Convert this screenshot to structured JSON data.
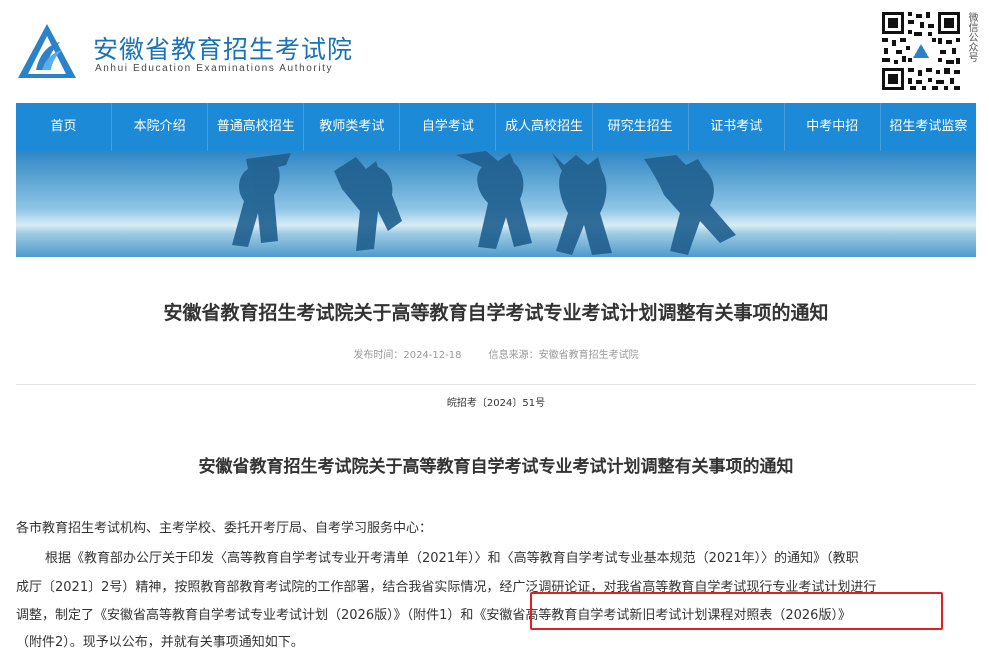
{
  "header": {
    "org_name_cn": "安徽省教育招生考试院",
    "org_name_en": "Anhui Education Examinations Authority",
    "qr_label": "微信公众号"
  },
  "nav": {
    "items": [
      "首页",
      "本院介绍",
      "普通高校招生",
      "教师类考试",
      "自学考试",
      "成人高校招生",
      "研究生招生",
      "证书考试",
      "中考中招",
      "招生考试监察"
    ]
  },
  "article": {
    "title": "安徽省教育招生考试院关于高等教育自学考试专业考试计划调整有关事项的通知",
    "publish_time": "发布时间：2024-12-18",
    "source": "信息来源：安徽省教育招生考试院",
    "doc_number": "皖招考〔2024〕51号",
    "notice_title": "安徽省教育招生考试院关于高等教育自学考试专业考试计划调整有关事项的通知",
    "lines": [
      "各市教育招生考试机构、主考学校、委托开考厅局、自考学习服务中心：",
      "根据《教育部办公厅关于印发〈高等教育自学考试专业开考清单（2021年）〉和〈高等教育自学考试专业基本规范（2021年）〉的通知》（教职",
      "成厅〔2021〕2号）精神，按照教育部教育考试院的工作部署，结合我省实际情况，经广泛调研论证，对我省高等教育自学考试现行专业考试计划进行",
      "调整，制定了《安徽省高等教育自学考试专业考试计划（2026版）》（附件1）和《安徽省高等教育自学考试新旧考试计划课程对照表（2026版）》",
      "（附件2）。现予以公布，并就有关事项通知如下。"
    ]
  },
  "colors": {
    "nav_bg": "#1c8ad6",
    "brand_blue": "#1a72b8",
    "highlight_border": "#e02020"
  }
}
